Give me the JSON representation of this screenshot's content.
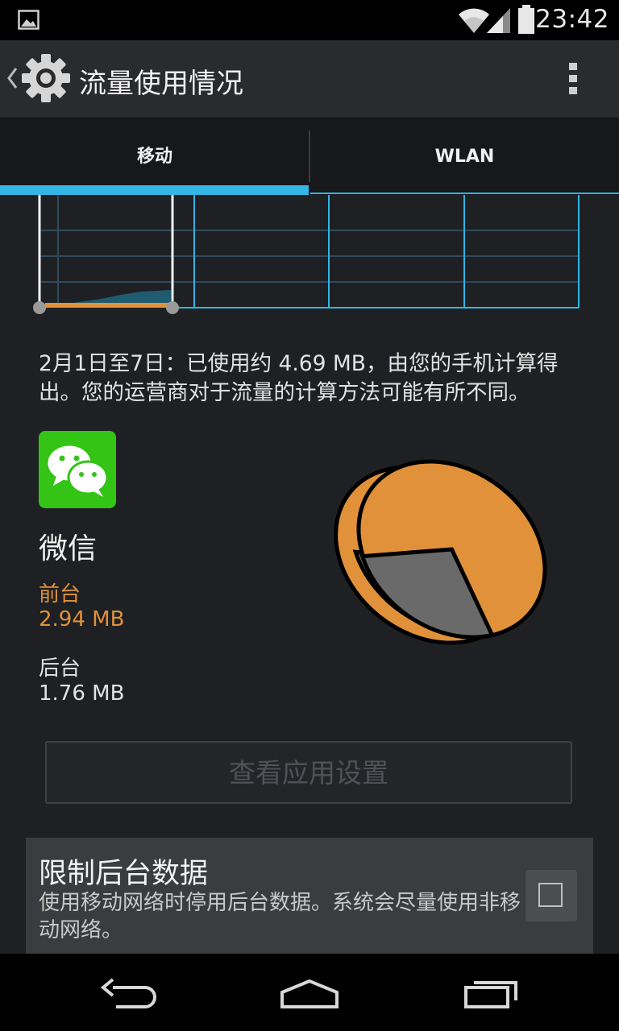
{
  "status_bar": {
    "time": "23:42",
    "icons": [
      "image-notification-icon",
      "wifi-icon",
      "signal-icon",
      "battery-icon"
    ]
  },
  "action_bar": {
    "title": "流量使用情况",
    "icons": [
      "back-chevron-icon",
      "settings-gear-icon",
      "overflow-menu-icon"
    ]
  },
  "tabs": [
    {
      "label": "移动",
      "selected": true
    },
    {
      "label": "WLAN",
      "selected": false
    }
  ],
  "usage_summary": "2月1日至7日：已使用约 4.69 MB，由您的手机计算得出。您的运营商对于流量的计算方法可能有所不同。",
  "app": {
    "name": "微信",
    "icon": "wechat-icon",
    "foreground": {
      "label": "前台",
      "value": "2.94 MB"
    },
    "background": {
      "label": "后台",
      "value": "1.76 MB"
    }
  },
  "pie_chart": {
    "foreground_mb": 2.94,
    "background_mb": 1.76,
    "colors": {
      "foreground": "#e0913a",
      "background": "#6a6a6a"
    }
  },
  "app_settings_button": {
    "label": "查看应用设置",
    "enabled": false
  },
  "restrict_background": {
    "title": "限制后台数据",
    "description": "使用移动网络时停用后台数据。系统会尽量使用非移动网络。",
    "checked": false
  },
  "nav_bar": {
    "icons": [
      "back-icon",
      "home-icon",
      "recents-icon"
    ]
  },
  "colors": {
    "accent": "#33b5e5",
    "foreground_usage": "#e0913a",
    "app_icon_green": "#33c415"
  }
}
